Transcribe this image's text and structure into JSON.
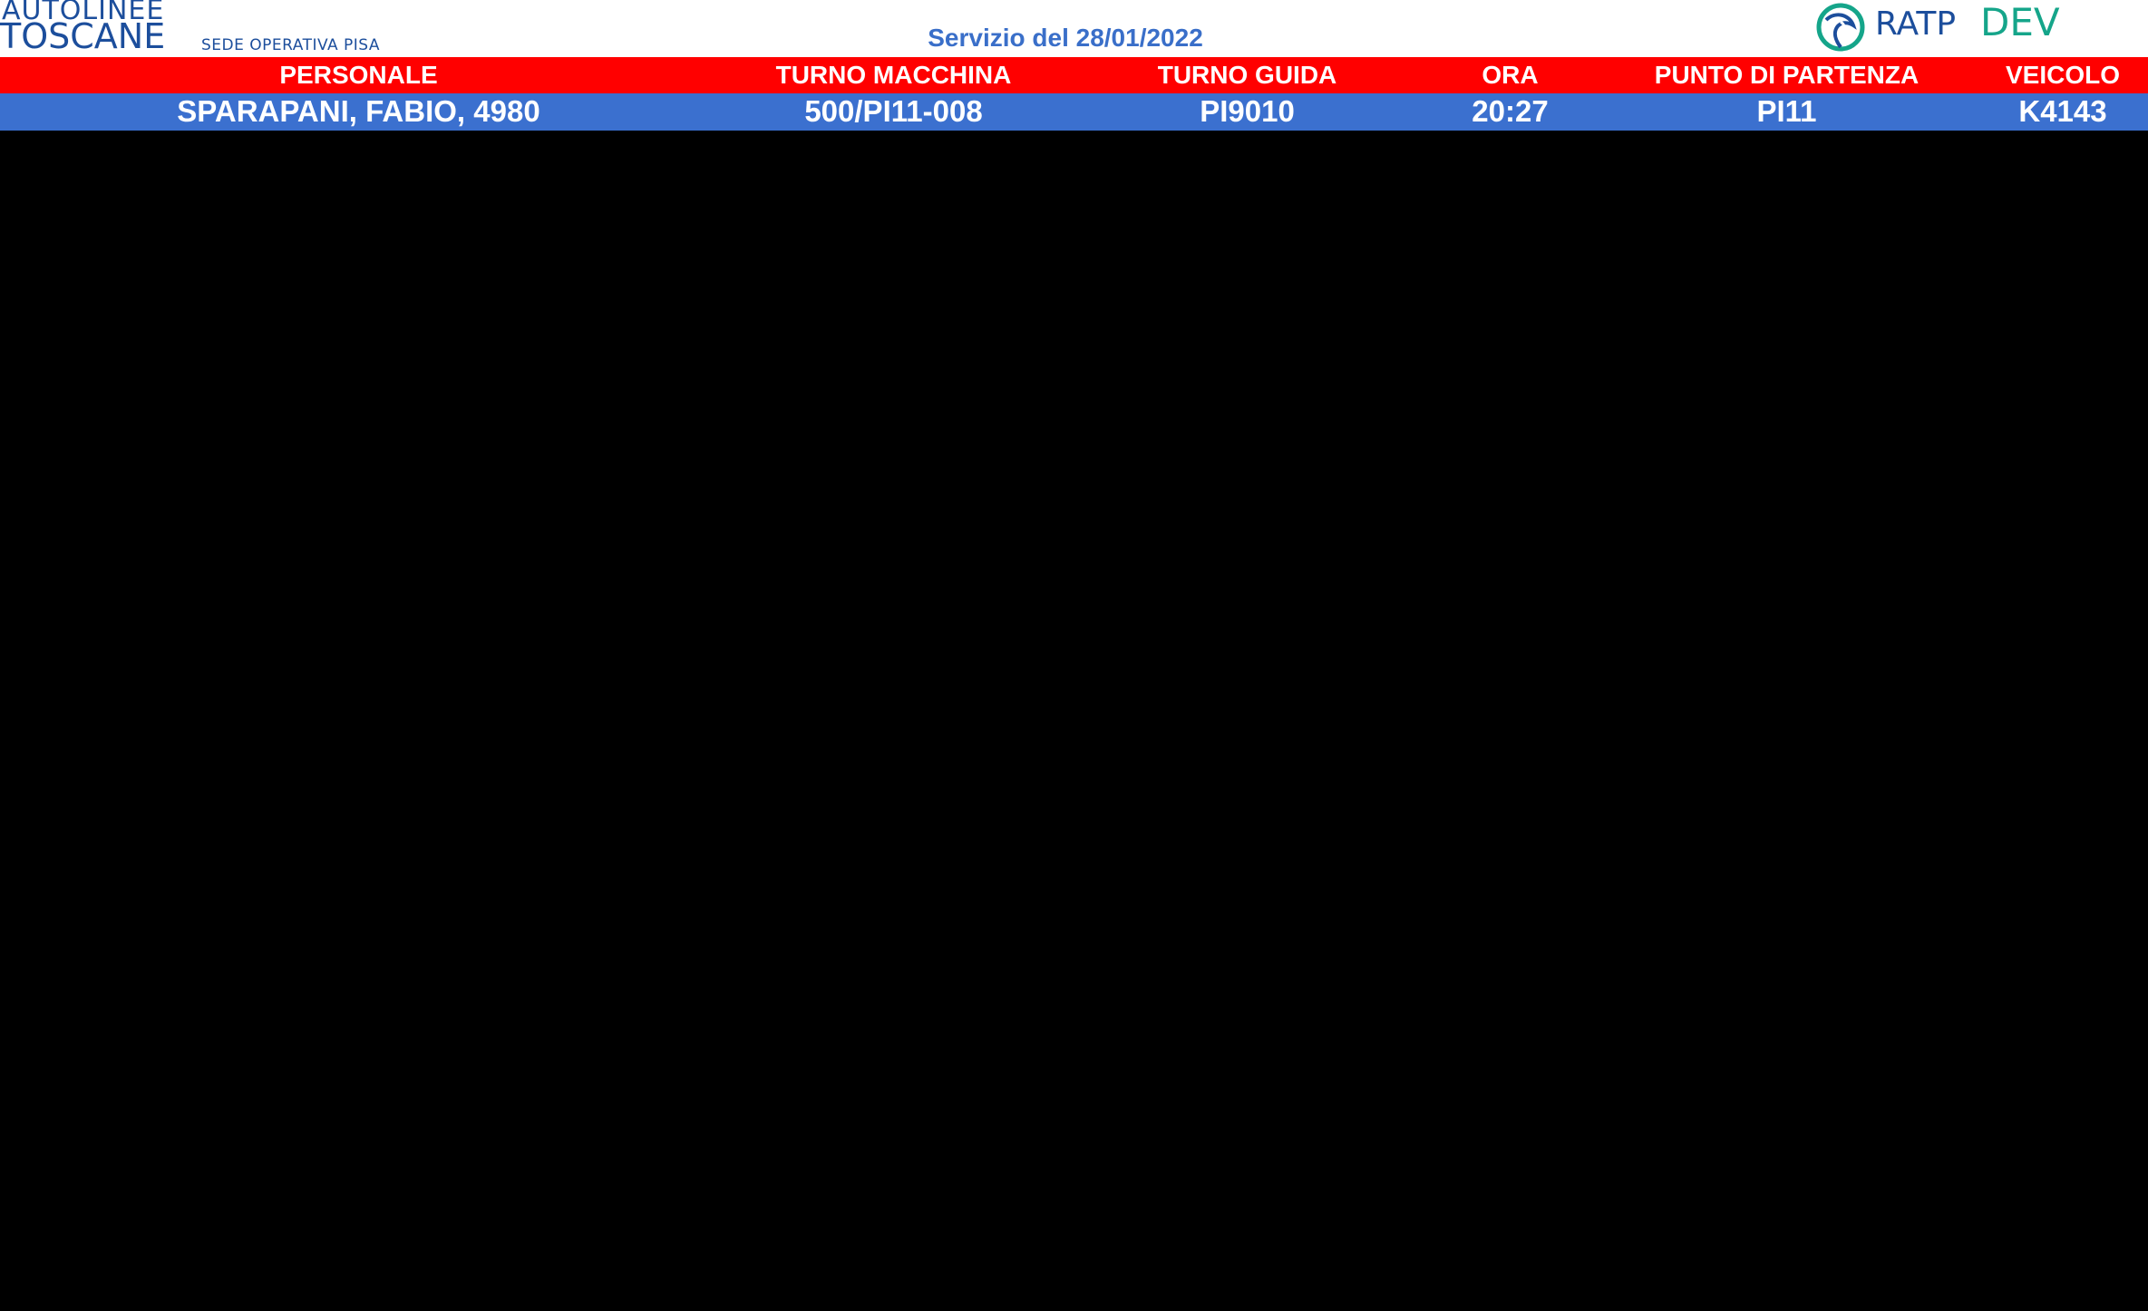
{
  "header": {
    "brand_line1": "AUTOLINEE",
    "brand_line2": "TOSCANE",
    "brand_sub": "SEDE OPERATIVA PISA",
    "service_title": "Servizio del 28/01/2022",
    "partner_logo": {
      "icon": "ratp-swirl-icon",
      "text_ratp": "RATP",
      "text_dev": "DEV",
      "color_ratp": "#1c4e9c",
      "color_dev": "#15a58a"
    }
  },
  "table": {
    "header_color": "#ff0000",
    "row_color": "#3b70cf",
    "columns": [
      "PERSONALE",
      "TURNO MACCHINA",
      "TURNO GUIDA",
      "ORA",
      "PUNTO DI PARTENZA",
      "VEICOLO"
    ],
    "rows": [
      [
        "SPARAPANI, FABIO, 4980",
        "500/PI11-008",
        "PI9010",
        "20:27",
        "PI11",
        "K4143"
      ]
    ]
  }
}
